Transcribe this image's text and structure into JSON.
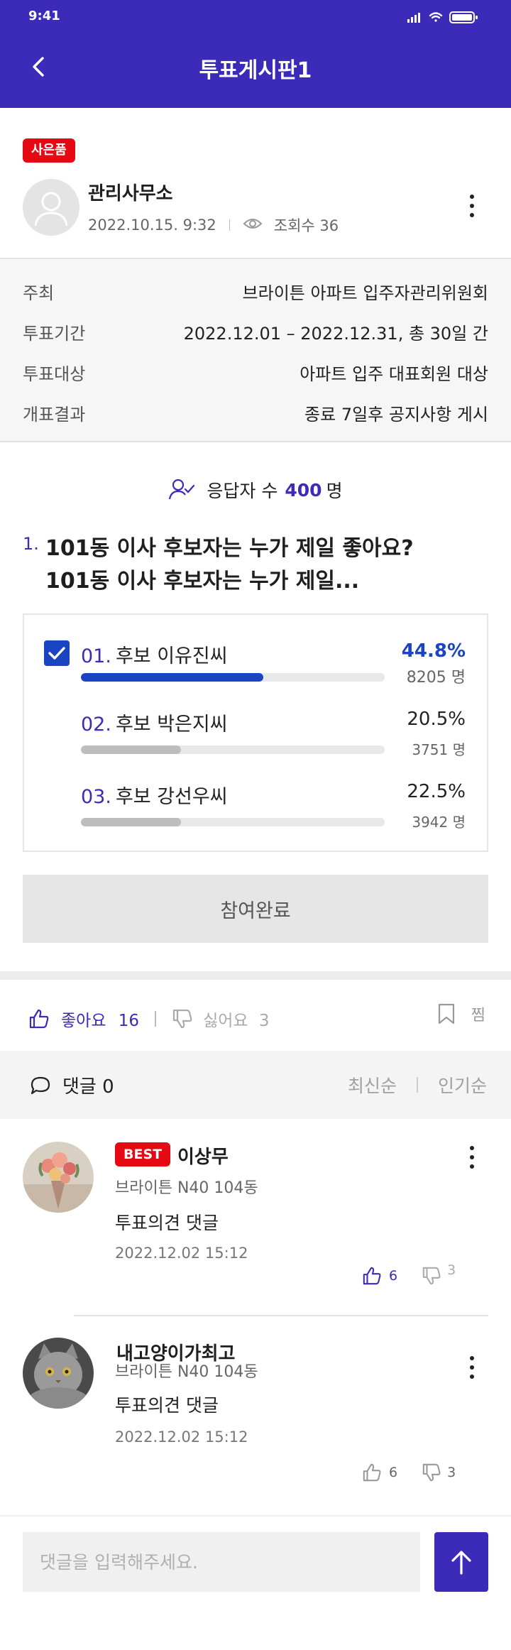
{
  "status_bar": {
    "time": "9:41"
  },
  "header": {
    "title": "투표게시판1"
  },
  "post": {
    "badge": "사은품",
    "author": "관리사무소",
    "date": "2022.10.15. 9:32",
    "views": "조회수 36"
  },
  "info": [
    {
      "label": "주최",
      "value": "브라이튼 아파트 입주자관리위원회"
    },
    {
      "label": "투표기간",
      "value": "2022.12.01 – 2022.12.31, 총 30일 간"
    },
    {
      "label": "투표대상",
      "value": "아파트 입주 대표회원 대상"
    },
    {
      "label": "개표결과",
      "value": "종료 7일후 공지사항 게시"
    }
  ],
  "vote": {
    "respondents_label": "응답자 수",
    "respondents_count": "400",
    "respondents_unit": "명",
    "question_number": "1.",
    "question_line1": "101동 이사 후보자는 누가 제일 좋아요?",
    "question_line2": "101동 이사 후보자는 누가 제일...",
    "options": [
      {
        "num": "01.",
        "label": "후보 이유진씨",
        "percent": "44.8%",
        "count": "8205 명",
        "fraction": 0.6,
        "selected": true
      },
      {
        "num": "02.",
        "label": "후보 박은지씨",
        "percent": "20.5%",
        "count": "3751 명",
        "fraction": 0.33,
        "selected": false
      },
      {
        "num": "03.",
        "label": "후보 강선우씨",
        "percent": "22.5%",
        "count": "3942 명",
        "fraction": 0.33,
        "selected": false
      }
    ],
    "done_label": "참여완료"
  },
  "reactions": {
    "like_label": "좋아요",
    "like_count": "16",
    "dislike_label": "싫어요",
    "dislike_count": "3",
    "bookmark_label": "찜"
  },
  "comments_header": {
    "label": "댓글 0",
    "sort_latest": "최신순",
    "sort_popular": "인기순"
  },
  "comments": [
    {
      "badge": "BEST",
      "name": "이상무",
      "address": "브라이튼 N40 104동",
      "text": "투표의견 댓글",
      "date": "2022.12.02 15:12",
      "likes": "6",
      "dislikes": "3"
    },
    {
      "name": "내고양이가최고",
      "address": "브라이튼 N40 104동",
      "text": "투표의견 댓글",
      "date": "2022.12.02 15:12",
      "likes": "6",
      "dislikes": "3"
    }
  ],
  "comment_input": {
    "placeholder": "댓글을 입력해주세요."
  },
  "colors": {
    "primary": "#3c2ab9",
    "badge_red": "#e50914",
    "selected_blue": "#1a44c2"
  }
}
